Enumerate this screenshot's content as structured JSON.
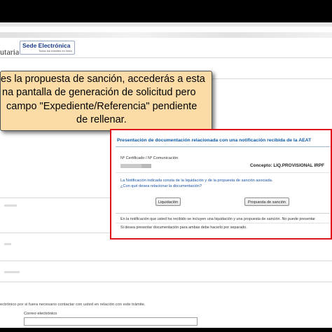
{
  "header": {
    "brand_fragment": "utaria",
    "logo_title": "Sede Electrónica",
    "logo_subtitle": "Todos los trámites en línea"
  },
  "tooltip": {
    "lines": [
      "es la propuesta de sanción, accederás a esta",
      "na pantalla de generación de solicitud pero",
      "campo \"Expediente/Referencia\" pendiente",
      "de rellenar."
    ]
  },
  "modal": {
    "title": "Presentación de documentación relacionada con una notificación recibida de la AEAT",
    "cert_label": "Nº Certificado / Nº Comunicación",
    "concepto": "Concepto: LIQ.PROVISIONAL IRPF",
    "question_line1": "La Notificación indicada consta de la liquidación y de la propuesta de sanción asociada.",
    "question_line2": "¿Con qué desea relacionar la documentación?",
    "button_liquidacion": "Liquidación",
    "button_propuesta": "Propuesta de sanción",
    "info_line1": "En la notificación que usted ha recibido se incluyen una liquidación y una propuesta de sanción.  No puede presentar",
    "info_line2": "Si desea presentar documentación para ambas debe hacerlo por separado."
  },
  "footer": {
    "contact_text": "ectrónico por si fuera necesario contactar con usted en relación con este trámite.",
    "email_label": "Correo electrónico",
    "email_value": ""
  }
}
